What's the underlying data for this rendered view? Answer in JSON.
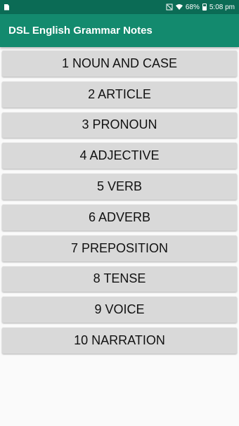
{
  "status_bar": {
    "battery": "68%",
    "time": "5:08 pm",
    "icons": [
      "sim-icon",
      "mute-icon",
      "wifi-icon",
      "signal-icon",
      "battery-icon"
    ]
  },
  "app_bar": {
    "title": "DSL English Grammar Notes",
    "color": "#138a6e"
  },
  "topics": [
    {
      "label": "1 NOUN AND CASE"
    },
    {
      "label": "2 ARTICLE"
    },
    {
      "label": "3 PRONOUN"
    },
    {
      "label": "4 ADJECTIVE"
    },
    {
      "label": "5 VERB"
    },
    {
      "label": "6 ADVERB"
    },
    {
      "label": "7 PREPOSITION"
    },
    {
      "label": "8 TENSE"
    },
    {
      "label": "9 VOICE"
    },
    {
      "label": "10 NARRATION"
    }
  ]
}
